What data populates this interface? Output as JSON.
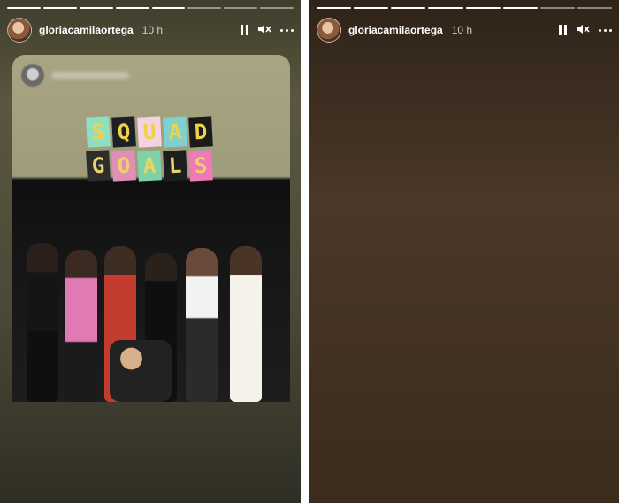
{
  "stories": [
    {
      "username": "gloriacamilaortega",
      "time": "10 h",
      "sticker": {
        "line1": [
          "S",
          "Q",
          "U",
          "A",
          "D"
        ],
        "line2": [
          "G",
          "O",
          "A",
          "L",
          "S"
        ]
      }
    },
    {
      "username": "gloriacamilaortega",
      "time": "10 h"
    }
  ],
  "icons": {
    "pause": "pause-icon",
    "mute": "volume-muted-icon",
    "more": "more-options-icon"
  }
}
